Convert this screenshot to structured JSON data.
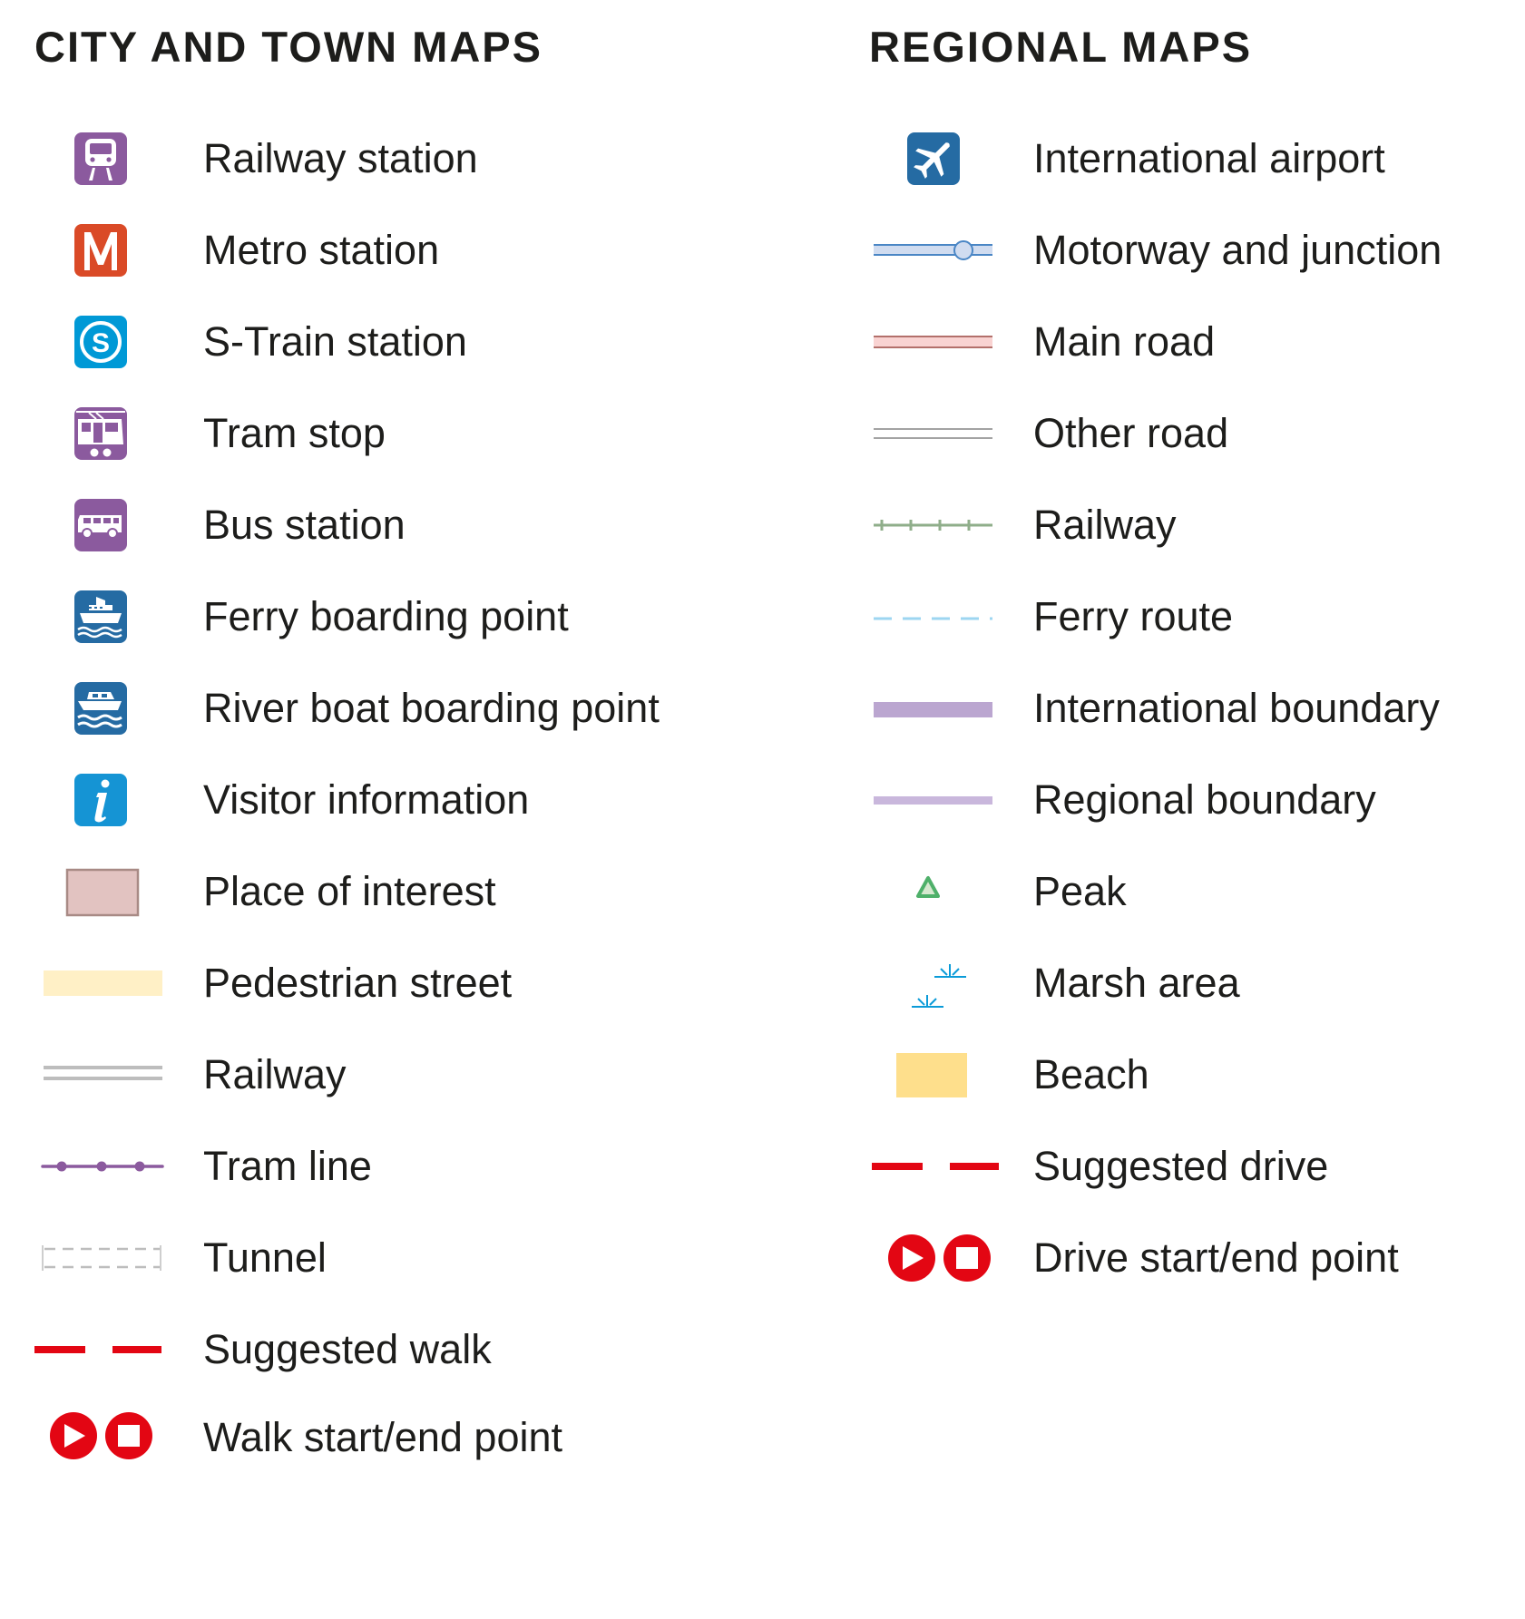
{
  "headings": {
    "city": "CITY AND TOWN MAPS",
    "regional": "REGIONAL MAPS"
  },
  "colors": {
    "text": "#1d1d1b",
    "purple": "#8b5a9e",
    "metro": "#da4a27",
    "s_train": "#0099d6",
    "ferry_blue": "#256ba3",
    "info_blue": "#1594d4",
    "red": "#e30613"
  },
  "city_legend": [
    {
      "icon": "railway-station-icon",
      "label": "Railway station"
    },
    {
      "icon": "metro-station-icon",
      "label": "Metro station",
      "glyph": "M"
    },
    {
      "icon": "s-train-station-icon",
      "label": "S-Train station",
      "glyph": "S"
    },
    {
      "icon": "tram-stop-icon",
      "label": "Tram stop"
    },
    {
      "icon": "bus-station-icon",
      "label": "Bus station"
    },
    {
      "icon": "ferry-icon",
      "label": "Ferry boarding point"
    },
    {
      "icon": "river-boat-icon",
      "label": "River boat boarding point"
    },
    {
      "icon": "info-icon",
      "label": "Visitor information",
      "glyph": "i"
    },
    {
      "icon": "place-of-interest-swatch",
      "label": "Place of interest"
    },
    {
      "icon": "pedestrian-street-swatch",
      "label": "Pedestrian street"
    },
    {
      "icon": "railway-line-icon",
      "label": "Railway"
    },
    {
      "icon": "tram-line-icon",
      "label": "Tram line"
    },
    {
      "icon": "tunnel-icon",
      "label": "Tunnel"
    },
    {
      "icon": "suggested-walk-icon",
      "label": "Suggested walk"
    },
    {
      "icon": "walk-start-end-icon",
      "label": "Walk start/end point"
    }
  ],
  "regional_legend": [
    {
      "icon": "airport-icon",
      "label": "International airport"
    },
    {
      "icon": "motorway-junction-icon",
      "label": "Motorway and junction"
    },
    {
      "icon": "main-road-icon",
      "label": "Main road"
    },
    {
      "icon": "other-road-icon",
      "label": "Other road"
    },
    {
      "icon": "railway-line-icon",
      "label": "Railway"
    },
    {
      "icon": "ferry-route-icon",
      "label": "Ferry route"
    },
    {
      "icon": "international-boundary-icon",
      "label": "International boundary"
    },
    {
      "icon": "regional-boundary-icon",
      "label": "Regional boundary"
    },
    {
      "icon": "peak-icon",
      "label": "Peak"
    },
    {
      "icon": "marsh-icon",
      "label": "Marsh area"
    },
    {
      "icon": "beach-swatch",
      "label": "Beach"
    },
    {
      "icon": "suggested-drive-icon",
      "label": "Suggested drive"
    },
    {
      "icon": "drive-start-end-icon",
      "label": "Drive start/end point"
    }
  ]
}
